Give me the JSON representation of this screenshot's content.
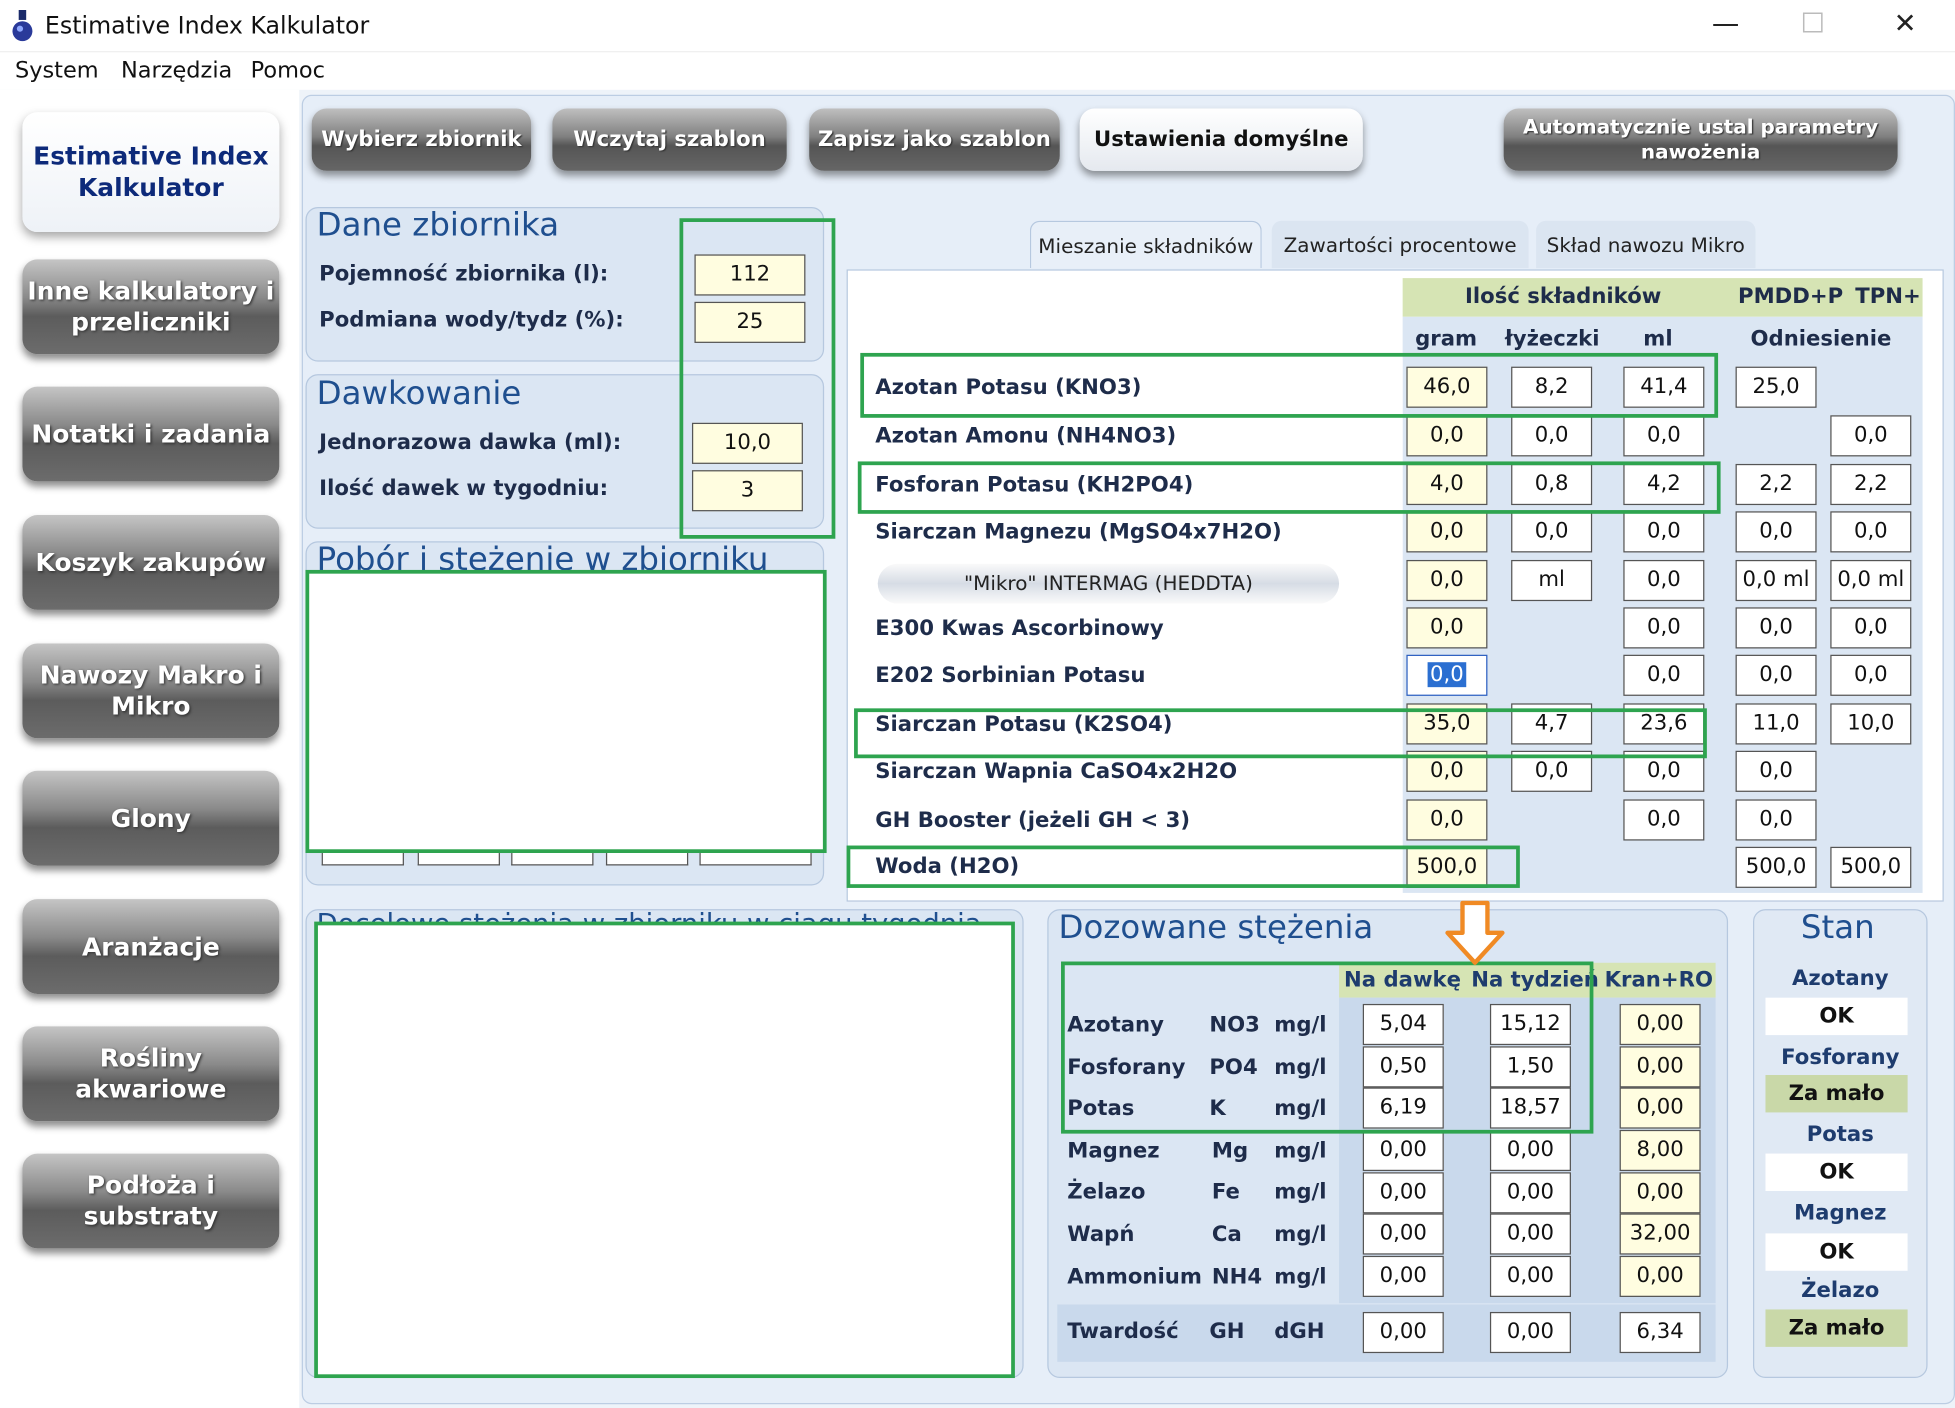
{
  "window": {
    "title": "Estimative Index Kalkulator",
    "minimize": "—",
    "maximize": "☐",
    "close": "✕"
  },
  "menu": {
    "system": "System",
    "narzedzia": "Narzędzia",
    "pomoc": "Pomoc"
  },
  "nav": {
    "active": "Estimative Index Kalkulator",
    "items": [
      "Inne kalkulatory i przeliczniki",
      "Notatki i zadania",
      "Koszyk zakupów",
      "Nawozy Makro i Mikro",
      "Glony",
      "Aranżacje",
      "Rośliny akwariowe",
      "Podłoża i substraty"
    ]
  },
  "toolbar": {
    "wybierz": "Wybierz zbiornik",
    "wczytaj": "Wczytaj szablon",
    "zapisz": "Zapisz jako szablon",
    "ustawienia": "Ustawienia domyślne",
    "auto": "Automatycznie ustal parametry nawożenia"
  },
  "tank": {
    "title": "Dane zbiornika",
    "capacity_label": "Pojemność zbiornika (l):",
    "capacity": "112",
    "water_change_label": "Podmiana wody/tydz (%):",
    "water_change": "25"
  },
  "dosing": {
    "title": "Dawkowanie",
    "dose_label": "Jednorazowa dawka (ml):",
    "dose": "10,0",
    "doses_label": "Ilość dawek w tygodniu:",
    "doses": "3"
  },
  "uptake": {
    "title": "Pobór i stężenie w zbiorniku"
  },
  "weekly": {
    "title": "Docelowe stężenia w zbiorniku w ciągu tygodnia"
  },
  "tabs": [
    "Mieszanie składników",
    "Zawartości procentowe",
    "Skład nawozu Mikro"
  ],
  "mix": {
    "hdr_amount": "Ilość składników",
    "hdr_pmdd": "PMDD+P",
    "hdr_tpn": "TPN+",
    "hdr_gram": "gram",
    "hdr_spoon": "łyżeczki",
    "hdr_ml": "ml",
    "hdr_ref": "Odniesienie",
    "rows": [
      {
        "name": "Azotan Potasu (KNO3)",
        "gram": "46,0",
        "spoon": "8,2",
        "ml": "41,4",
        "pmdd": "25,0",
        "tpn": ""
      },
      {
        "name": "Azotan Amonu (NH4NO3)",
        "gram": "0,0",
        "spoon": "0,0",
        "ml": "0,0",
        "pmdd": "",
        "tpn": "0,0"
      },
      {
        "name": "Fosforan Potasu (KH2PO4)",
        "gram": "4,0",
        "spoon": "0,8",
        "ml": "4,2",
        "pmdd": "2,2",
        "tpn": "2,2"
      },
      {
        "name": "Siarczan Magnezu (MgSO4x7H2O)",
        "gram": "0,0",
        "spoon": "0,0",
        "ml": "0,0",
        "pmdd": "0,0",
        "tpn": "0,0"
      },
      {
        "name": "\"Mikro\" INTERMAG (HEDDTA)",
        "gram": "0,0",
        "spoon": "ml",
        "ml": "0,0",
        "pmdd": "0,0 ml",
        "tpn": "0,0 ml"
      },
      {
        "name": "E300 Kwas Ascorbinowy",
        "gram": "0,0",
        "spoon": "",
        "ml": "0,0",
        "pmdd": "0,0",
        "tpn": "0,0"
      },
      {
        "name": "E202 Sorbinian Potasu",
        "gram": "0,0",
        "spoon": "",
        "ml": "0,0",
        "pmdd": "0,0",
        "tpn": "0,0"
      },
      {
        "name": "Siarczan Potasu (K2SO4)",
        "gram": "35,0",
        "spoon": "4,7",
        "ml": "23,6",
        "pmdd": "11,0",
        "tpn": "10,0"
      },
      {
        "name": "Siarczan Wapnia CaSO4x2H2O",
        "gram": "0,0",
        "spoon": "0,0",
        "ml": "0,0",
        "pmdd": "0,0",
        "tpn": ""
      },
      {
        "name": "GH Booster (jeżeli GH < 3)",
        "gram": "0,0",
        "spoon": "",
        "ml": "0,0",
        "pmdd": "0,0",
        "tpn": ""
      },
      {
        "name": "Woda (H2O)",
        "gram": "500,0",
        "spoon": "",
        "ml": "",
        "pmdd": "500,0",
        "tpn": "500,0"
      }
    ]
  },
  "dosed": {
    "title": "Dozowane stężenia",
    "hdr_dose": "Na dawkę",
    "hdr_week": "Na tydzień",
    "hdr_tap": "Kran+RO",
    "rows": [
      {
        "name": "Azotany",
        "sym": "NO3",
        "unit": "mg/l",
        "dose": "5,04",
        "week": "15,12",
        "tap": "0,00"
      },
      {
        "name": "Fosforany",
        "sym": "PO4",
        "unit": "mg/l",
        "dose": "0,50",
        "week": "1,50",
        "tap": "0,00"
      },
      {
        "name": "Potas",
        "sym": "K",
        "unit": "mg/l",
        "dose": "6,19",
        "week": "18,57",
        "tap": "0,00"
      },
      {
        "name": "Magnez",
        "sym": "Mg",
        "unit": "mg/l",
        "dose": "0,00",
        "week": "0,00",
        "tap": "8,00"
      },
      {
        "name": "Żelazo",
        "sym": "Fe",
        "unit": "mg/l",
        "dose": "0,00",
        "week": "0,00",
        "tap": "0,00"
      },
      {
        "name": "Wapń",
        "sym": "Ca",
        "unit": "mg/l",
        "dose": "0,00",
        "week": "0,00",
        "tap": "32,00"
      },
      {
        "name": "Ammonium",
        "sym": "NH4",
        "unit": "mg/l",
        "dose": "0,00",
        "week": "0,00",
        "tap": "0,00"
      }
    ],
    "hardness": {
      "name": "Twardość",
      "sym": "GH",
      "unit": "dGH",
      "dose": "0,00",
      "week": "0,00",
      "tap": "6,34"
    }
  },
  "stan": {
    "title": "Stan",
    "items": [
      {
        "label": "Azotany",
        "value": "OK"
      },
      {
        "label": "Fosforany",
        "value": "Za mało"
      },
      {
        "label": "Potas",
        "value": "OK"
      },
      {
        "label": "Magnez",
        "value": "OK"
      },
      {
        "label": "Żelazo",
        "value": "Za mało"
      }
    ]
  },
  "colors": {
    "accent_green": "#2ea44f",
    "arrow_orange": "#f08a24",
    "input_yellow": "#fffde0",
    "title_blue": "#1f4f8f"
  }
}
